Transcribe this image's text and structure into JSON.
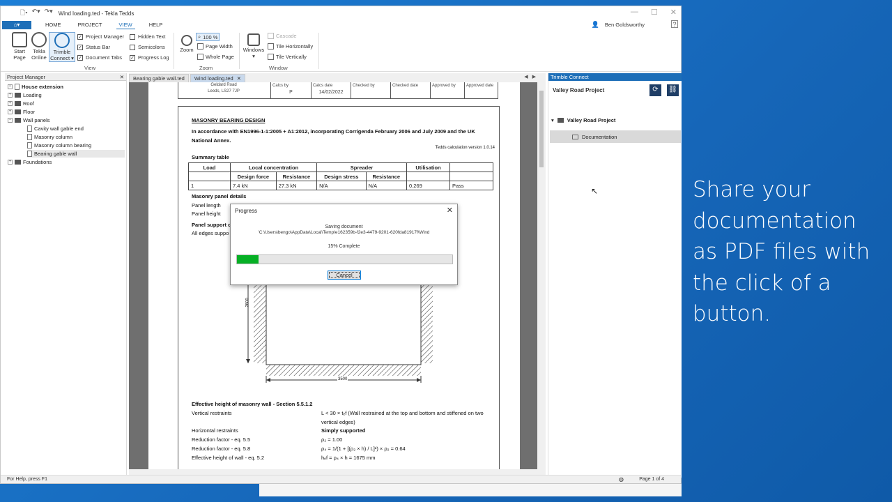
{
  "promo_text": "Share your documentation as PDF files with the click of a button.",
  "window": {
    "title": "Wind loading.ted - Tekla Tedds",
    "user": "Ben Goldsworthy",
    "help": "?"
  },
  "ribbon": {
    "tabs": [
      "HOME",
      "PROJECT",
      "VIEW",
      "HELP"
    ],
    "active_tab": "VIEW",
    "big_buttons": [
      {
        "label": "Start Page"
      },
      {
        "label": "Tekla Online"
      },
      {
        "label": "Trimble Connect ▾"
      },
      {
        "label": "Zoom"
      },
      {
        "label": "Windows ▾"
      }
    ],
    "view_checks": [
      {
        "label": "Project Manager",
        "checked": true
      },
      {
        "label": "Status Bar",
        "checked": true
      },
      {
        "label": "Document Tabs",
        "checked": true
      },
      {
        "label": "Hidden Text",
        "checked": false
      },
      {
        "label": "Semicolons",
        "checked": false
      },
      {
        "label": "Progress Log",
        "checked": true
      }
    ],
    "zoom_items": [
      "100 %",
      "Page Width",
      "Whole Page"
    ],
    "window_items": [
      "Cascade",
      "Tile Horizontally",
      "Tile Vertically"
    ],
    "group_labels": {
      "view": "View",
      "zoom": "Zoom",
      "window": "Window"
    }
  },
  "project_manager": {
    "title": "Project Manager",
    "items": [
      {
        "label": "House extension",
        "level": 0
      },
      {
        "label": "Loading",
        "level": 1
      },
      {
        "label": "Roof",
        "level": 1
      },
      {
        "label": "Floor",
        "level": 1
      },
      {
        "label": "Wall panels",
        "level": 1
      },
      {
        "label": "Cavity wall gable end",
        "level": 2
      },
      {
        "label": "Masonry column",
        "level": 2
      },
      {
        "label": "Masonry column bearing",
        "level": 2
      },
      {
        "label": "Bearing gable wall",
        "level": 2
      },
      {
        "label": "Foundations",
        "level": 1
      }
    ]
  },
  "doc_tabs": [
    {
      "label": "Bearing gable wall.ted",
      "active": false
    },
    {
      "label": "Wind loading.ted",
      "active": true
    }
  ],
  "doc_header": {
    "address_1": "Geldard Road",
    "address_2": "Leeds, LS27 7JP",
    "calcs_by_label": "Calcs by",
    "calcs_by": "P",
    "calcs_date_label": "Calcs date",
    "calcs_date": "14/02/2022",
    "checked_by_label": "Checked by",
    "checked_date_label": "Checked date",
    "approved_by_label": "Approved by",
    "approved_date_label": "Approved date"
  },
  "doc": {
    "heading": "MASONRY BEARING DESIGN",
    "standard_1": "In accordance with EN1996-1-1:2005 + A1:2012, incorporating Corrigenda February 2006 and July 2009 and the UK",
    "standard_2": "National Annex.",
    "version": "Tedds calculation version 1.0.14",
    "summary_title": "Summary table",
    "summary": {
      "h_load": "Load",
      "h_local": "Local concentration",
      "h_spreader": "Spreader",
      "h_util": "Utilisation",
      "h_df": "Design force",
      "h_res1": "Resistance",
      "h_ds": "Design stress",
      "h_res2": "Resistance",
      "row": [
        "1",
        "7.4 kN",
        "27.3 kN",
        "N/A",
        "N/A",
        "0.269",
        "Pass"
      ]
    },
    "panel_details": "Masonry panel details",
    "panel_length": "Panel length",
    "panel_height": "Panel height",
    "panel_support": "Panel support c",
    "edges": "All edges suppo",
    "dim_h": "2600",
    "dim_w": "3500",
    "eff_title": "Effective height of masonry wall - Section 5.5.1.2",
    "vert_label": "Vertical restraints",
    "vert_val_1": "L < 30 × tₑf (Wall restrained at the top and bottom and stiffened on two",
    "vert_val_2": "vertical edges)",
    "horiz_label": "Horizontal restraints",
    "horiz_val": "Simply supported",
    "rf1_label": "Reduction factor - eq. 5.5",
    "rf1_val": "ρ₂ = 1.00",
    "rf2_label": "Reduction factor - eq. 5.8",
    "rf2_val": "ρ₄ = 1/(1 + [(ρ₂ × h) / L]²) × ρ₂ = 0.64",
    "ehw_label": "Effective height of wall - eq. 5.2",
    "ehw_val": "hₑf = ρ₄ × h = 1675 mm"
  },
  "progress": {
    "title": "Progress",
    "status": "Saving document",
    "path": "'C:\\Users\\bengo\\AppData\\Local\\Temp\\e162359b-f2e3-4479-9201-620fda81917f\\Wind",
    "percent_text": "15% Complete",
    "percent": 0.1,
    "cancel": "Cancel"
  },
  "trimble": {
    "title": "Trimble Connect",
    "project": "Valley Road Project",
    "tree_root": "Valley Road Project",
    "tree_child": "Documentation"
  },
  "status": {
    "help": "For Help, press F1",
    "page": "Page 1 of 4"
  }
}
